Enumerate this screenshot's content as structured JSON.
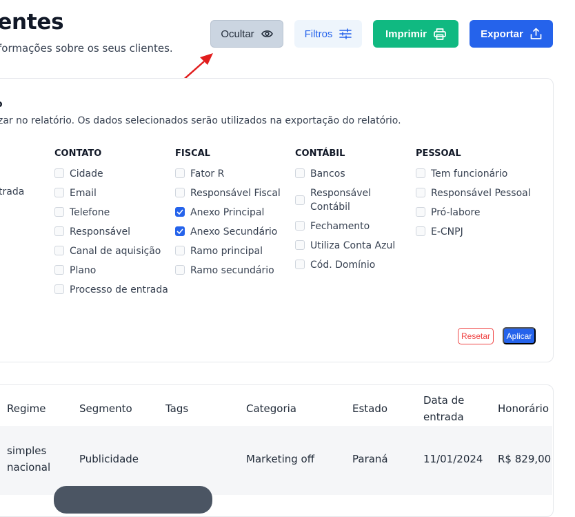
{
  "header": {
    "title": "ientes",
    "subtitle": "formações sobre os seus clientes."
  },
  "actions": {
    "hide_label": "Ocultar",
    "filters_label": "Filtros",
    "print_label": "Imprimir",
    "export_label": "Exportar"
  },
  "panel": {
    "title": "o",
    "description": "zar no relatório. Os dados selecionados serão utilizados na exportação do relatório.",
    "partial_option": "trada",
    "columns": [
      {
        "heading": "CONTATO",
        "options": [
          {
            "label": "Cidade",
            "checked": false
          },
          {
            "label": "Email",
            "checked": false
          },
          {
            "label": "Telefone",
            "checked": false
          },
          {
            "label": "Responsável",
            "checked": false
          },
          {
            "label": "Canal de aquisição",
            "checked": false
          },
          {
            "label": "Plano",
            "checked": false
          },
          {
            "label": "Processo de entrada",
            "checked": false
          }
        ]
      },
      {
        "heading": "FISCAL",
        "options": [
          {
            "label": "Fator R",
            "checked": false
          },
          {
            "label": "Responsável Fiscal",
            "checked": false
          },
          {
            "label": "Anexo Principal",
            "checked": true
          },
          {
            "label": "Anexo Secundário",
            "checked": true
          },
          {
            "label": "Ramo principal",
            "checked": false
          },
          {
            "label": "Ramo secundário",
            "checked": false
          }
        ]
      },
      {
        "heading": "CONTÁBIL",
        "options": [
          {
            "label": "Bancos",
            "checked": false
          },
          {
            "label": "Responsável Contábil",
            "checked": false
          },
          {
            "label": "Fechamento",
            "checked": false
          },
          {
            "label": "Utiliza Conta Azul",
            "checked": false
          },
          {
            "label": "Cód. Domínio",
            "checked": false
          }
        ]
      },
      {
        "heading": "PESSOAL",
        "options": [
          {
            "label": "Tem funcionário",
            "checked": false
          },
          {
            "label": "Responsável Pessoal",
            "checked": false
          },
          {
            "label": "Pró-labore",
            "checked": false
          },
          {
            "label": "E-CNPJ",
            "checked": false
          }
        ]
      }
    ],
    "reset_label": "Resetar",
    "apply_label": "Aplicar"
  },
  "table": {
    "headers": [
      "Regime",
      "Segmento",
      "Tags",
      "Categoria",
      "Estado",
      "Data de entrada",
      "Honorário"
    ],
    "rows": [
      {
        "regime": "simples nacional",
        "segmento": "Publicidade",
        "tags": "",
        "categoria": "Marketing off",
        "estado": "Paraná",
        "data": "11/01/2024",
        "honorario": "R$ 829,00"
      }
    ]
  },
  "colors": {
    "primary": "#2563eb",
    "success": "#10b981",
    "danger": "#ef4444",
    "annotation_arrow": "#e11d1d"
  }
}
